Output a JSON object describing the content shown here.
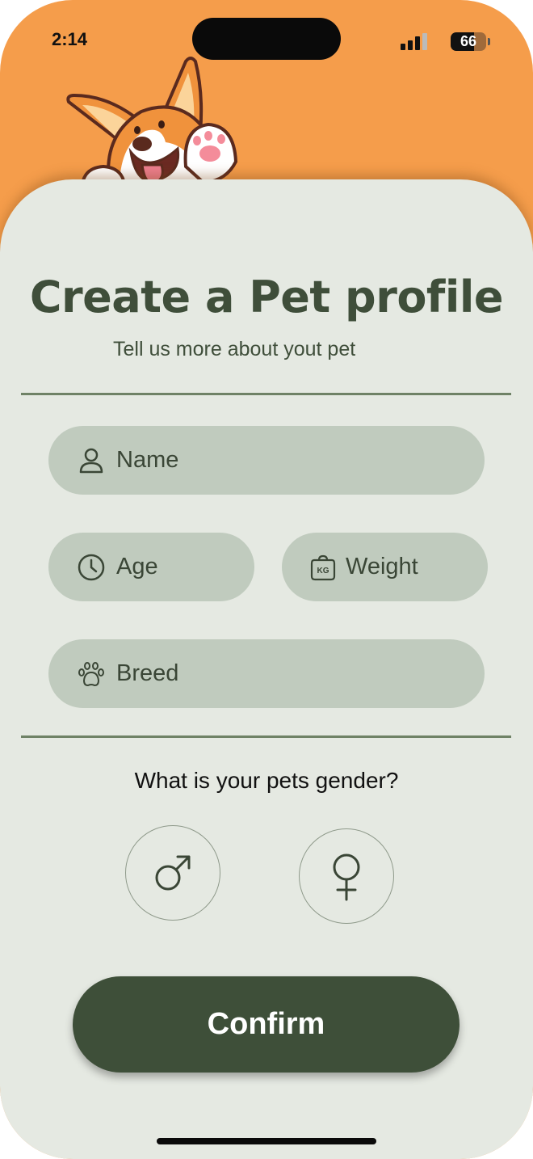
{
  "status_bar": {
    "time": "2:14",
    "battery": "66"
  },
  "header": {
    "title": "Create a Pet profile",
    "subtitle": "Tell us more about yout pet"
  },
  "form": {
    "name_placeholder": "Name",
    "age_placeholder": "Age",
    "weight_placeholder": "Weight",
    "breed_placeholder": "Breed",
    "weight_icon_text": "KG"
  },
  "gender": {
    "question": "What is your pets gender?",
    "options": [
      "male",
      "female"
    ]
  },
  "actions": {
    "confirm_label": "Confirm"
  },
  "colors": {
    "header_background": "#f59d4b",
    "card_background": "#e5e9e2",
    "field_background": "#c0cbbe",
    "primary": "#3e4f39",
    "divider": "#6f8266"
  }
}
